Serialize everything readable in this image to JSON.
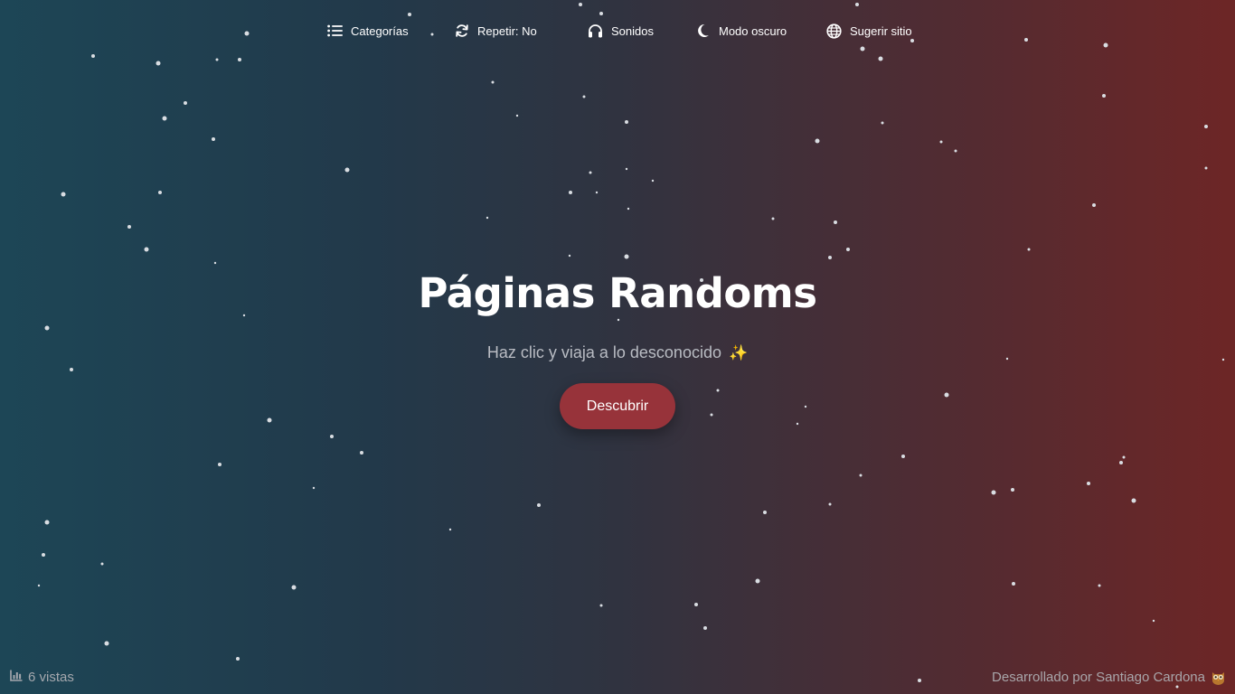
{
  "nav": {
    "categories": {
      "label": "Categorías",
      "icon": "list-icon"
    },
    "repeat": {
      "label": "Repetir: No",
      "icon": "refresh-icon"
    },
    "sounds": {
      "label": "Sonidos",
      "icon": "headphones-icon"
    },
    "dark_mode": {
      "label": "Modo oscuro",
      "icon": "moon-icon"
    },
    "suggest": {
      "label": "Sugerir sitio",
      "icon": "globe-icon"
    }
  },
  "hero": {
    "title": "Páginas Randoms",
    "subtitle": "Haz clic y viaja a lo desconocido",
    "sparkle": "✨",
    "button_label": "Descubrir"
  },
  "footer": {
    "views": "6 vistas",
    "views_icon": "bar-chart-icon",
    "credits": "Desarrollado por Santiago Cardona",
    "credits_icon": "owl-icon"
  },
  "colors": {
    "gradient_left": "#1d4656",
    "gradient_right": "#6d2626",
    "button": "#97333a",
    "subtitle": "#b9bcc3"
  }
}
